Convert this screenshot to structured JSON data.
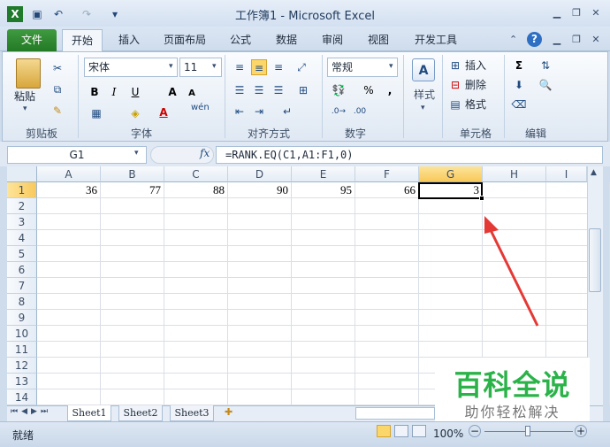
{
  "window": {
    "title": "工作簿1 - Microsoft Excel",
    "qat_icons": [
      "save-icon",
      "undo-icon",
      "redo-icon",
      "customize-qat-icon"
    ],
    "controls": [
      "minimize-icon",
      "restore-icon",
      "close-icon"
    ]
  },
  "tabs": [
    "文件",
    "开始",
    "插入",
    "页面布局",
    "公式",
    "数据",
    "审阅",
    "视图",
    "开发工具"
  ],
  "active_tab": "开始",
  "ribbon": {
    "clipboard": {
      "paste": "粘贴",
      "label": "剪贴板"
    },
    "font": {
      "name": "宋体",
      "size": "11",
      "label": "字体",
      "bold": "B",
      "italic": "I",
      "underline": "U",
      "grow": "A",
      "shrink": "A",
      "color_a": "A",
      "wen": "wén"
    },
    "alignment": {
      "label": "对齐方式"
    },
    "number": {
      "format": "常规",
      "label": "数字",
      "percent": "%",
      "comma": ","
    },
    "styles": {
      "label": "样式"
    },
    "cells": {
      "insert": "插入",
      "delete": "删除",
      "format": "格式",
      "label": "单元格"
    },
    "editing": {
      "label": "编辑",
      "sum": "Σ"
    }
  },
  "formula_bar": {
    "name_box": "G1",
    "fx": "fx",
    "formula": "=RANK.EQ(C1,A1:F1,0)"
  },
  "columns": [
    "A",
    "B",
    "C",
    "D",
    "E",
    "F",
    "G",
    "H",
    "I"
  ],
  "rows": [
    "1",
    "2",
    "3",
    "4",
    "5",
    "6",
    "7",
    "8",
    "9",
    "10",
    "11",
    "12",
    "13",
    "14"
  ],
  "cells": {
    "A1": "36",
    "B1": "77",
    "C1": "88",
    "D1": "90",
    "E1": "95",
    "F1": "66",
    "G1": "3"
  },
  "selected_cell": "G1",
  "sheets": [
    "Sheet1",
    "Sheet2",
    "Sheet3"
  ],
  "active_sheet": "Sheet1",
  "status": {
    "mode": "就绪",
    "zoom": "100%"
  },
  "watermark": {
    "title": "百科全说",
    "subtitle": "助你轻松解决"
  },
  "colors": {
    "file_tab": "#2a7d2b",
    "selection_border": "#000000",
    "arrow": "#e53935",
    "watermark_green": "#2bb34a"
  }
}
